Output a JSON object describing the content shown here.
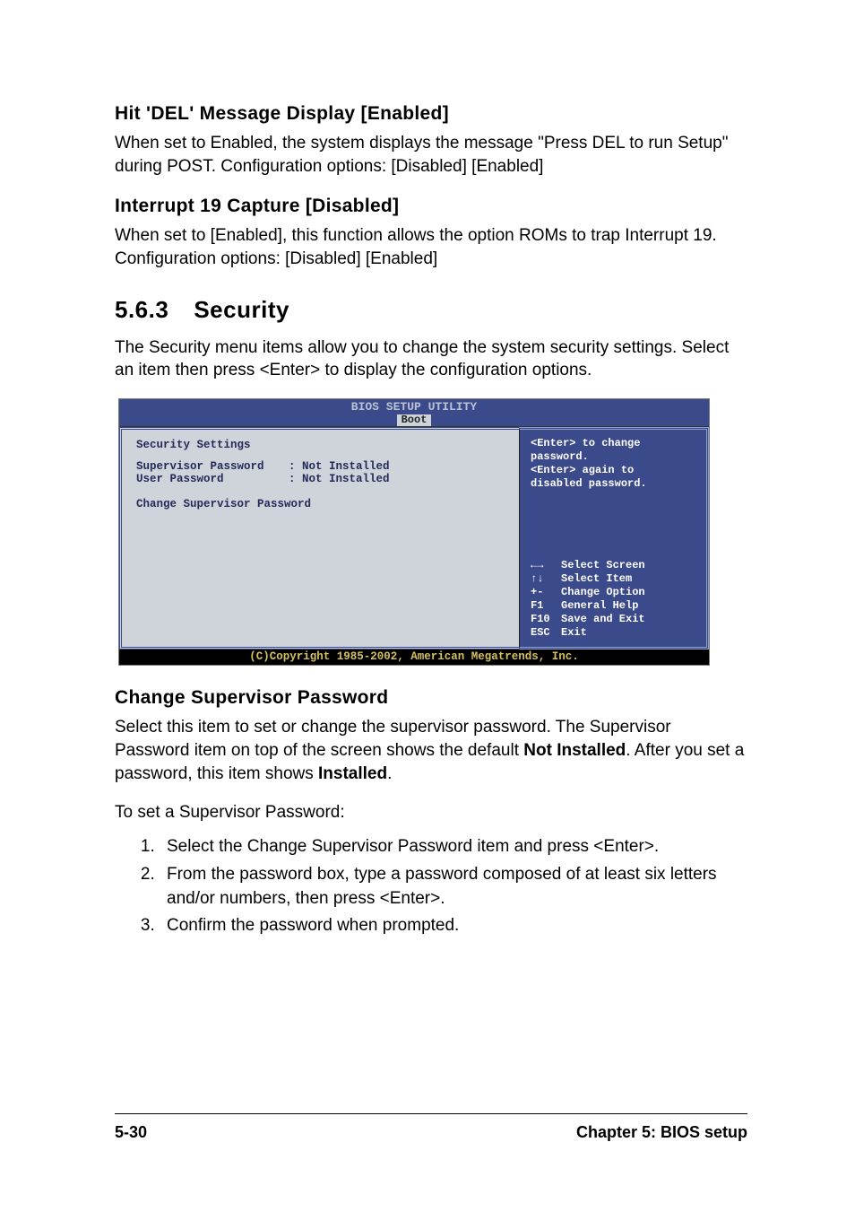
{
  "section1": {
    "heading": "Hit 'DEL' Message Display [Enabled]",
    "body": "When set to Enabled, the system displays the message \"Press DEL to run Setup\" during POST. Configuration options: [Disabled] [Enabled]"
  },
  "section2": {
    "heading": "Interrupt 19 Capture [Disabled]",
    "body": "When set to [Enabled], this function allows the option ROMs to trap Interrupt 19. Configuration options: [Disabled] [Enabled]"
  },
  "section3": {
    "num": "5.6.3",
    "title": "Security",
    "intro": "The Security menu items allow you to change the system security settings. Select an item then press <Enter> to display the configuration options."
  },
  "bios": {
    "title": "BIOS SETUP UTILITY",
    "tab": "Boot",
    "left": {
      "heading": "Security Settings",
      "rows": [
        {
          "label": "Supervisor Password",
          "value": ": Not Installed"
        },
        {
          "label": "User Password",
          "value": ": Not Installed"
        }
      ],
      "action": "Change Supervisor Password"
    },
    "right": {
      "help_line1": "<Enter> to change",
      "help_line2": "password.",
      "help_line3": "<Enter> again to",
      "help_line4": "disabled password.",
      "keys": [
        {
          "key": "←→",
          "label": "Select Screen"
        },
        {
          "key": "↑↓",
          "label": "Select Item"
        },
        {
          "key": "+-",
          "label": "Change Option"
        },
        {
          "key": "F1",
          "label": "General Help"
        },
        {
          "key": "F10",
          "label": "Save and Exit"
        },
        {
          "key": "ESC",
          "label": "Exit"
        }
      ]
    },
    "footer": "(C)Copyright 1985-2002, American Megatrends, Inc."
  },
  "section4": {
    "heading": "Change Supervisor Password",
    "para_pre": "Select this item to set or change the supervisor password. The Supervisor Password item on top of the screen shows the default ",
    "bold1": "Not Installed",
    "para_mid": ". After you set a password, this item shows ",
    "bold2": "Installed",
    "para_post": ".",
    "list_intro": "To set a Supervisor Password:",
    "steps": [
      "Select the Change Supervisor Password item and press <Enter>.",
      "From the password box, type a password composed of at least six letters and/or numbers, then press <Enter>.",
      "Confirm the password when prompted."
    ]
  },
  "footer": {
    "left": "5-30",
    "right": "Chapter 5: BIOS setup"
  }
}
